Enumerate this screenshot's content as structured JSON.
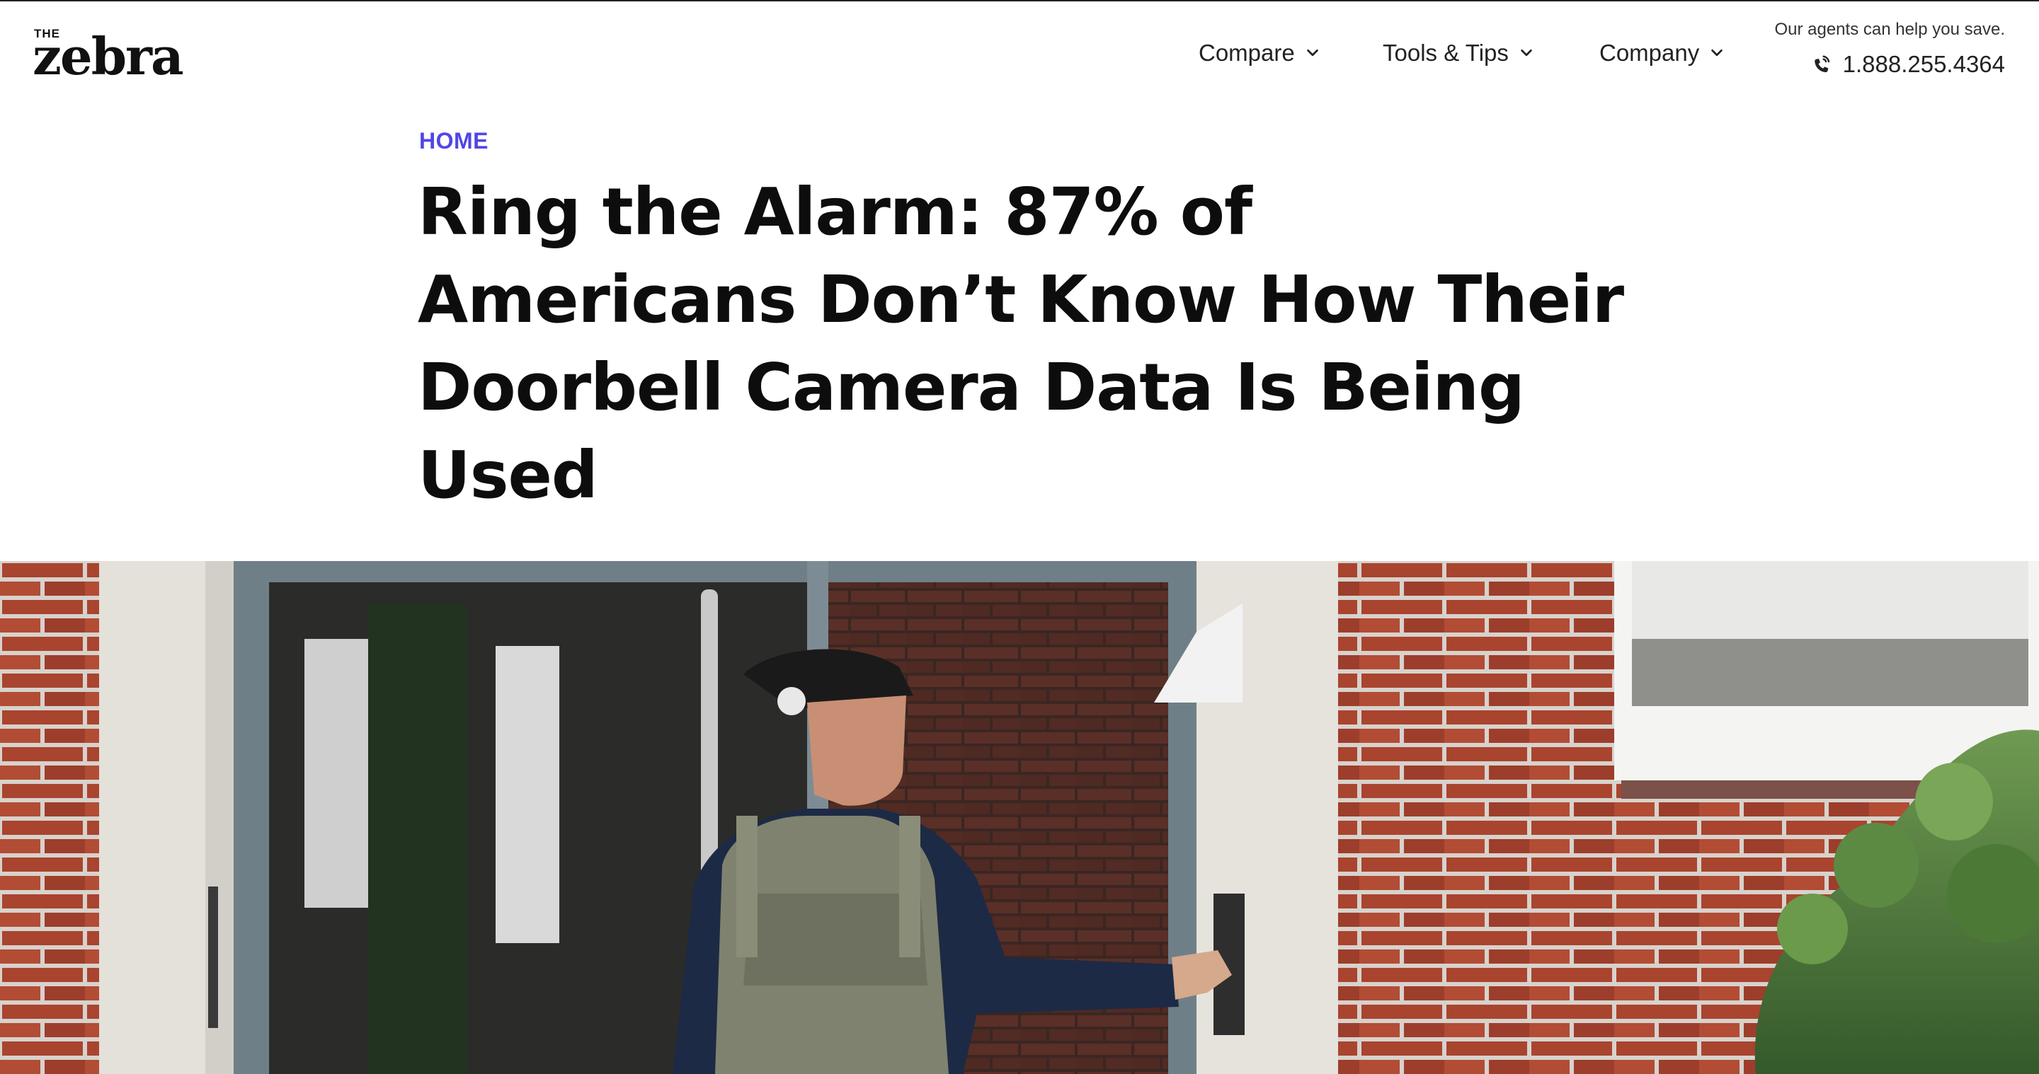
{
  "brand": {
    "logo_small": "THE",
    "logo_word": "zebra"
  },
  "nav": {
    "items": [
      {
        "label": "Compare",
        "icon": "chevron-down-icon"
      },
      {
        "label": "Tools & Tips",
        "icon": "chevron-down-icon"
      },
      {
        "label": "Company",
        "icon": "chevron-down-icon"
      }
    ]
  },
  "contact": {
    "helper_text": "Our agents can help you save.",
    "phone": "1.888.255.4364",
    "icon": "phone-icon"
  },
  "article": {
    "breadcrumb": "HOME",
    "title": "Ring the Alarm: 87% of Americans Don’t Know How Their Doorbell Camera Data Is Being Used"
  },
  "hero": {
    "description_icon": "hero-photo"
  },
  "colors": {
    "accent": "#5146e5",
    "brick": "#a9442f",
    "door_frame": "#6f7f88"
  }
}
